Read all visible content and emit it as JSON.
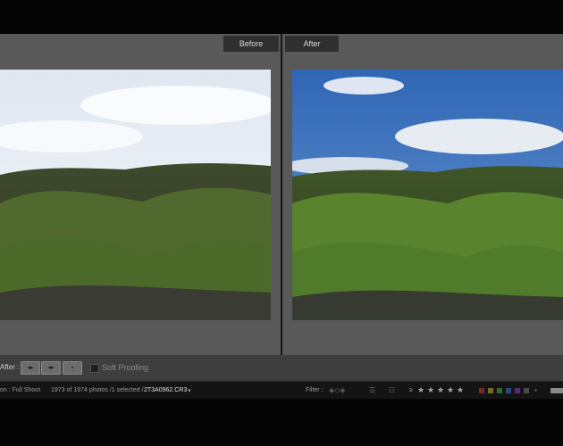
{
  "panes": {
    "before_label": "Before",
    "after_label": "After"
  },
  "toolbar": {
    "view_label": "After :",
    "swap_before_after_btn": "◂▸",
    "copy_after_to_before_btn": "◂▸",
    "swap_btn": "▪",
    "soft_proofing_label": "Soft Proofing"
  },
  "filmstrip": {
    "source_text": "on : Full Shoot",
    "count_text": "1973 of 1974 photos /1 selected /",
    "filename": "2T3A0962.CR3",
    "dropdown_glyph": "▾",
    "filter_label": "Filter :",
    "rating_op": "≥",
    "stars": [
      "★",
      "★",
      "★",
      "★",
      "★"
    ],
    "color_labels": [
      "#7a2a2a",
      "#7a6a2a",
      "#2f6a2f",
      "#2a4a7a",
      "#5a2a7a",
      "#4a4a4a"
    ]
  },
  "colors": {
    "workspace_bg": "#595959",
    "toolbar_bg": "#3e3e3e",
    "filmstrip_bg": "#141414",
    "sky_before": "#eef2f7",
    "sky_after": "#3f77c6",
    "grass": "#4d7a2a"
  }
}
